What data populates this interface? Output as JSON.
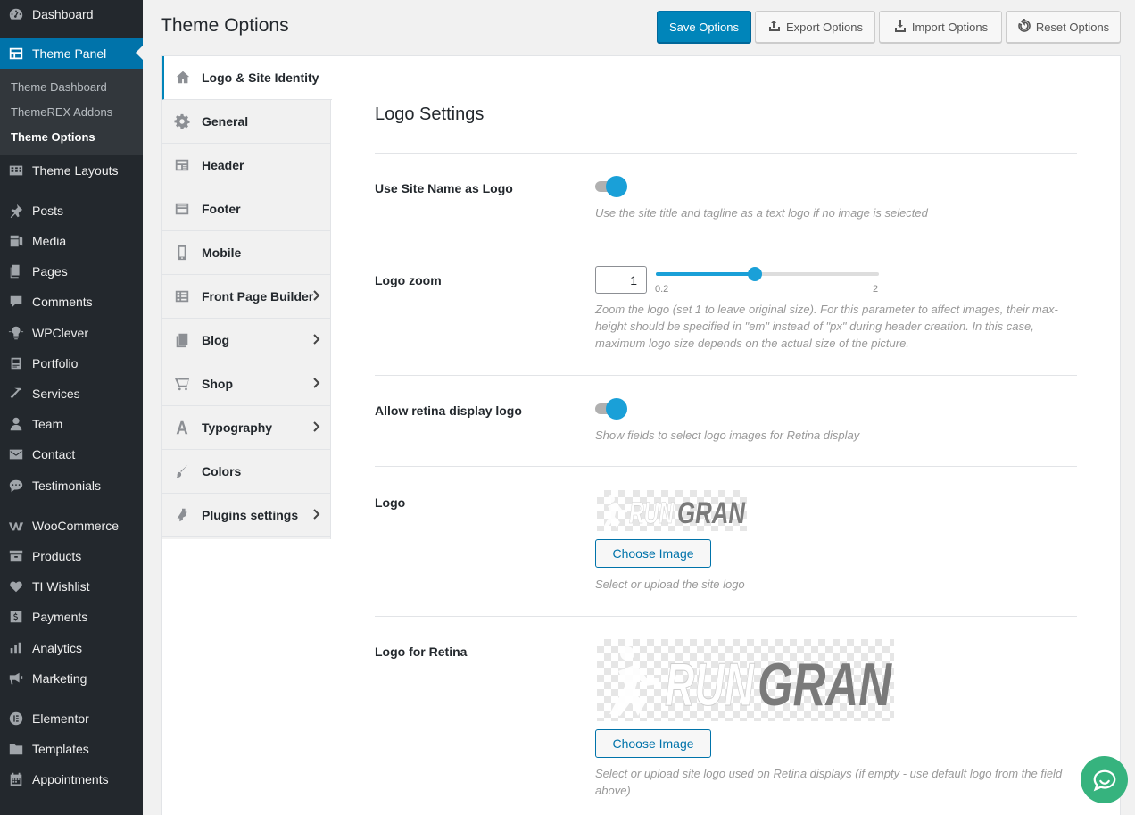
{
  "wp_menu": {
    "items": [
      {
        "label": "Dashboard",
        "icon": "dashboard-icon"
      },
      {
        "label": "Theme Panel",
        "icon": "theme-panel-icon"
      },
      {
        "label": "Theme Layouts",
        "icon": "layouts-icon"
      },
      {
        "label": "Posts",
        "icon": "pin-icon"
      },
      {
        "label": "Media",
        "icon": "media-icon"
      },
      {
        "label": "Pages",
        "icon": "pages-icon"
      },
      {
        "label": "Comments",
        "icon": "comments-icon"
      },
      {
        "label": "WPClever",
        "icon": "lightbulb-icon"
      },
      {
        "label": "Portfolio",
        "icon": "portfolio-icon"
      },
      {
        "label": "Services",
        "icon": "hammer-icon"
      },
      {
        "label": "Team",
        "icon": "user-icon"
      },
      {
        "label": "Contact",
        "icon": "envelope-icon"
      },
      {
        "label": "Testimonials",
        "icon": "chat-icon"
      },
      {
        "label": "WooCommerce",
        "icon": "woo-icon"
      },
      {
        "label": "Products",
        "icon": "archive-icon"
      },
      {
        "label": "TI Wishlist",
        "icon": "heart-icon"
      },
      {
        "label": "Payments",
        "icon": "dollar-icon"
      },
      {
        "label": "Analytics",
        "icon": "bar-chart-icon"
      },
      {
        "label": "Marketing",
        "icon": "megaphone-icon"
      },
      {
        "label": "Elementor",
        "icon": "elementor-icon"
      },
      {
        "label": "Templates",
        "icon": "folder-icon"
      },
      {
        "label": "Appointments",
        "icon": "calendar-icon"
      }
    ],
    "submenu": [
      "Theme Dashboard",
      "ThemeREX Addons",
      "Theme Options"
    ]
  },
  "header": {
    "title": "Theme Options",
    "save": "Save Options",
    "export": "Export Options",
    "import": "Import Options",
    "reset": "Reset Options"
  },
  "tabs": [
    {
      "label": "Logo & Site Identity",
      "icon": "home-icon",
      "arrow": false
    },
    {
      "label": "General",
      "icon": "gear-icon",
      "arrow": false
    },
    {
      "label": "Header",
      "icon": "header-layout-icon",
      "arrow": false
    },
    {
      "label": "Footer",
      "icon": "footer-layout-icon",
      "arrow": false
    },
    {
      "label": "Mobile",
      "icon": "mobile-icon",
      "arrow": false
    },
    {
      "label": "Front Page Builder",
      "icon": "grid-icon",
      "arrow": true
    },
    {
      "label": "Blog",
      "icon": "blog-icon",
      "arrow": true
    },
    {
      "label": "Shop",
      "icon": "cart-icon",
      "arrow": true
    },
    {
      "label": "Typography",
      "icon": "typography-icon",
      "arrow": true
    },
    {
      "label": "Colors",
      "icon": "brush-icon",
      "arrow": false
    },
    {
      "label": "Plugins settings",
      "icon": "plugin-icon",
      "arrow": true
    }
  ],
  "section": {
    "title": "Logo Settings",
    "use_site_name": {
      "label": "Use Site Name as Logo",
      "enabled": true,
      "description": "Use the site title and tagline as a text logo if no image is selected"
    },
    "logo_zoom": {
      "label": "Logo zoom",
      "value": "1",
      "min_label": "0.2",
      "max_label": "2",
      "min": 0.2,
      "max": 2,
      "current": 1,
      "description": "Zoom the logo (set 1 to leave original size). For this parameter to affect images, their max-height should be specified in \"em\" instead of \"px\" during header creation. In this case, maximum logo size depends on the actual size of the picture."
    },
    "retina": {
      "label": "Allow retina display logo",
      "enabled": true,
      "description": "Show fields to select logo images for Retina display"
    },
    "logo": {
      "label": "Logo",
      "image_text": "RUNGRAN",
      "button": "Choose Image",
      "description": "Select or upload the site logo"
    },
    "logo_retina": {
      "label": "Logo for Retina",
      "image_text": "RUNGRAN",
      "button": "Choose Image",
      "description": "Select or upload site logo used on Retina displays (if empty - use default logo from the field above)"
    }
  },
  "colors": {
    "accent": "#0085ba",
    "toggle": "#1aa0d8",
    "chat": "#36b37e"
  }
}
